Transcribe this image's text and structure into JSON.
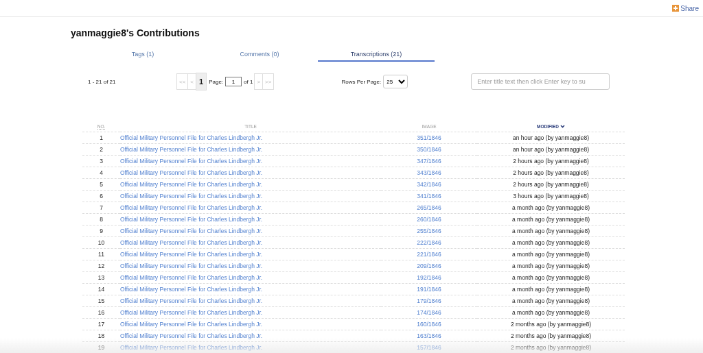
{
  "share": {
    "label": "Share"
  },
  "heading": "yanmaggie8's Contributions",
  "tabs": [
    {
      "label": "Tags (1)",
      "selected": false
    },
    {
      "label": "Comments (0)",
      "selected": false
    },
    {
      "label": "Transcriptions (21)",
      "selected": true
    }
  ],
  "range": "1 - 21 of 21",
  "pager": {
    "first": {
      "label": "<<",
      "disabled": true
    },
    "prev": {
      "label": "<",
      "disabled": true
    },
    "current": "1",
    "page_label": "Page:",
    "page_value": "1",
    "of_label": "of 1",
    "next": {
      "label": ">",
      "disabled": true
    },
    "last": {
      "label": ">>",
      "disabled": true
    }
  },
  "rows_per_page": {
    "label": "Rows Per Page:",
    "value": "25"
  },
  "search": {
    "placeholder": "Enter title text then click Enter key to su"
  },
  "table": {
    "columns": [
      {
        "label": "NO.",
        "sorted": false
      },
      {
        "label": "TITLE",
        "sorted": false
      },
      {
        "label": "IMAGE",
        "sorted": false
      },
      {
        "label": "MODIFIED",
        "sorted": true
      }
    ],
    "rows": [
      {
        "no": "1",
        "title": "Official Military Personnel File for Charles Lindbergh Jr.",
        "image": "351/1846",
        "modified": "an hour ago (by yanmaggie8)"
      },
      {
        "no": "2",
        "title": "Official Military Personnel File for Charles Lindbergh Jr.",
        "image": "350/1846",
        "modified": "an hour ago (by yanmaggie8)"
      },
      {
        "no": "3",
        "title": "Official Military Personnel File for Charles Lindbergh Jr.",
        "image": "347/1846",
        "modified": "2 hours ago (by yanmaggie8)"
      },
      {
        "no": "4",
        "title": "Official Military Personnel File for Charles Lindbergh Jr.",
        "image": "343/1846",
        "modified": "2 hours ago (by yanmaggie8)"
      },
      {
        "no": "5",
        "title": "Official Military Personnel File for Charles Lindbergh Jr.",
        "image": "342/1846",
        "modified": "2 hours ago (by yanmaggie8)"
      },
      {
        "no": "6",
        "title": "Official Military Personnel File for Charles Lindbergh Jr.",
        "image": "341/1846",
        "modified": "3 hours ago (by yanmaggie8)"
      },
      {
        "no": "7",
        "title": "Official Military Personnel File for Charles Lindbergh Jr.",
        "image": "265/1846",
        "modified": "a month ago (by yanmaggie8)"
      },
      {
        "no": "8",
        "title": "Official Military Personnel File for Charles Lindbergh Jr.",
        "image": "260/1846",
        "modified": "a month ago (by yanmaggie8)"
      },
      {
        "no": "9",
        "title": "Official Military Personnel File for Charles Lindbergh Jr.",
        "image": "255/1846",
        "modified": "a month ago (by yanmaggie8)"
      },
      {
        "no": "10",
        "title": "Official Military Personnel File for Charles Lindbergh Jr.",
        "image": "222/1846",
        "modified": "a month ago (by yanmaggie8)"
      },
      {
        "no": "11",
        "title": "Official Military Personnel File for Charles Lindbergh Jr.",
        "image": "221/1846",
        "modified": "a month ago (by yanmaggie8)"
      },
      {
        "no": "12",
        "title": "Official Military Personnel File for Charles Lindbergh Jr.",
        "image": "209/1846",
        "modified": "a month ago (by yanmaggie8)"
      },
      {
        "no": "13",
        "title": "Official Military Personnel File for Charles Lindbergh Jr.",
        "image": "192/1846",
        "modified": "a month ago (by yanmaggie8)"
      },
      {
        "no": "14",
        "title": "Official Military Personnel File for Charles Lindbergh Jr.",
        "image": "191/1846",
        "modified": "a month ago (by yanmaggie8)"
      },
      {
        "no": "15",
        "title": "Official Military Personnel File for Charles Lindbergh Jr.",
        "image": "179/1846",
        "modified": "a month ago (by yanmaggie8)"
      },
      {
        "no": "16",
        "title": "Official Military Personnel File for Charles Lindbergh Jr.",
        "image": "174/1846",
        "modified": "a month ago (by yanmaggie8)"
      },
      {
        "no": "17",
        "title": "Official Military Personnel File for Charles Lindbergh Jr.",
        "image": "160/1846",
        "modified": "2 months ago (by yanmaggie8)"
      },
      {
        "no": "18",
        "title": "Official Military Personnel File for Charles Lindbergh Jr.",
        "image": "163/1846",
        "modified": "2 months ago (by yanmaggie8)"
      },
      {
        "no": "19",
        "title": "Official Military Personnel File for Charles Lindbergh Jr.",
        "image": "157/1846",
        "modified": "2 months ago (by yanmaggie8)"
      }
    ]
  }
}
